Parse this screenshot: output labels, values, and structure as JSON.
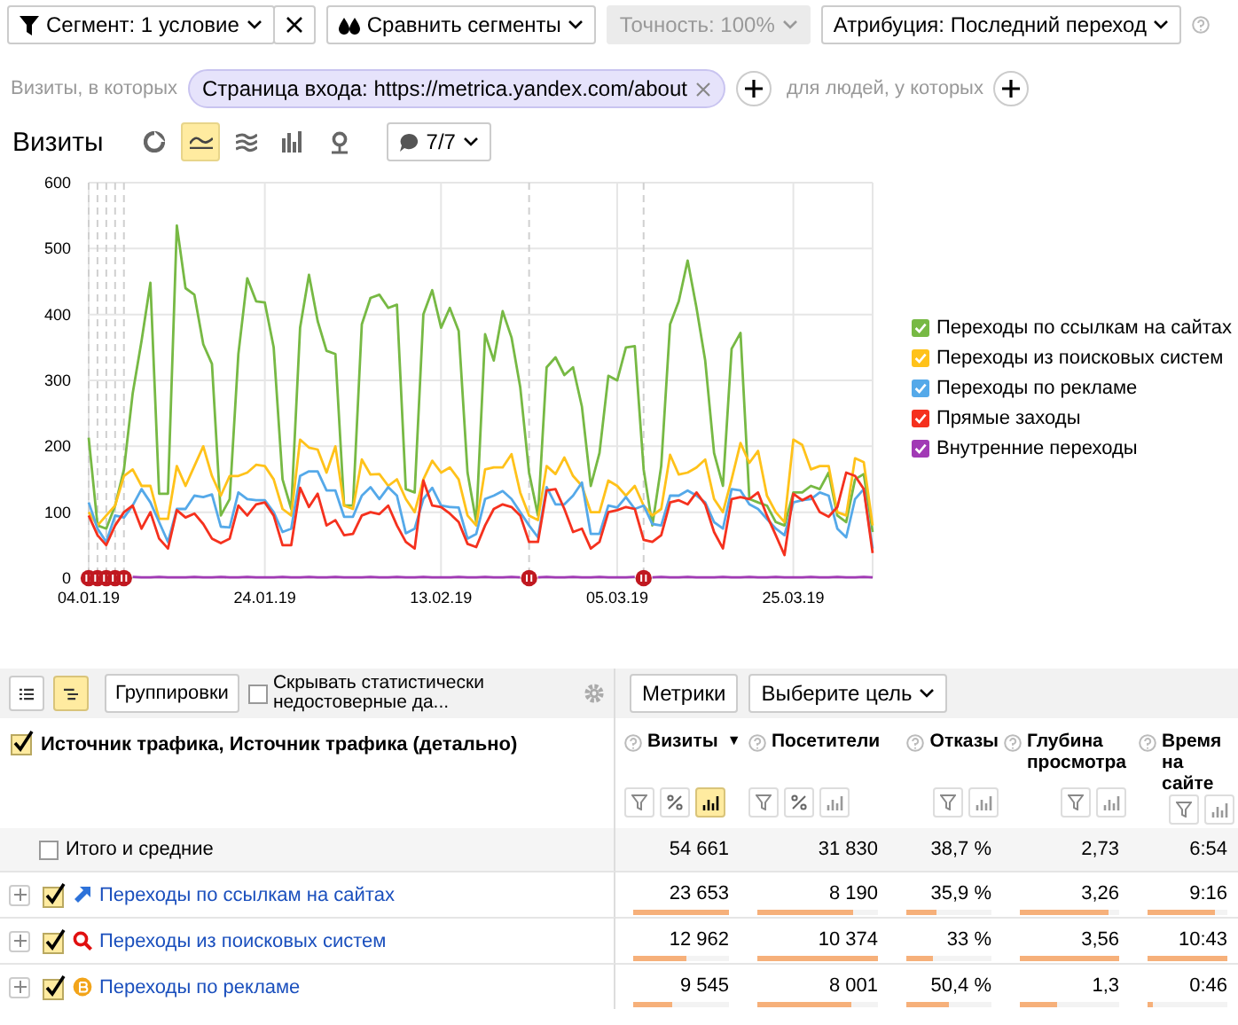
{
  "toolbar": {
    "items": [
      {
        "kind": "segment",
        "label": "Сегмент: 1 условие",
        "disabled": false
      },
      {
        "kind": "clear",
        "disabled": false
      },
      {
        "kind": "compare",
        "label": "Сравнить сегменты",
        "disabled": false
      },
      {
        "kind": "accuracy",
        "label": "Точность: 100%",
        "disabled": true
      },
      {
        "kind": "attribution",
        "label": "Атрибуция: Последний переход",
        "disabled": false
      }
    ]
  },
  "segment_filter": {
    "visits_label": "Визиты, в которых",
    "condition": "Страница входа: https://metrica.yandex.com/about",
    "people_label": "для людей, у которых"
  },
  "report": {
    "title": "Визиты",
    "views": [
      {
        "kind": "pie",
        "selected": false
      },
      {
        "kind": "line",
        "selected": true
      },
      {
        "kind": "area",
        "selected": false
      },
      {
        "kind": "bar",
        "selected": false
      },
      {
        "kind": "map",
        "selected": false
      }
    ],
    "notes_button": "7/7"
  },
  "chart": {
    "chart_data": {
      "type": "line",
      "categories": [
        "04.01.19",
        null,
        null,
        null,
        null,
        null,
        null,
        null,
        null,
        null,
        null,
        null,
        null,
        null,
        null,
        null,
        null,
        null,
        null,
        null,
        "24.01.19",
        null,
        null,
        null,
        null,
        null,
        null,
        null,
        null,
        null,
        null,
        null,
        null,
        null,
        null,
        null,
        null,
        null,
        null,
        null,
        "13.02.19",
        null,
        null,
        null,
        null,
        null,
        null,
        null,
        null,
        null,
        null,
        null,
        null,
        null,
        null,
        null,
        null,
        null,
        null,
        null,
        "05.03.19",
        null,
        null,
        null,
        null,
        null,
        null,
        null,
        null,
        null,
        null,
        null,
        null,
        null,
        null,
        null,
        null,
        null,
        null,
        null,
        "25.03.19",
        null,
        null,
        null,
        null,
        null,
        null,
        null,
        null,
        null
      ],
      "ylim": [
        0,
        600
      ],
      "grid": true,
      "yticks": [
        0,
        100,
        200,
        300,
        400,
        500,
        600
      ],
      "series": [
        {
          "name": "Переходы по ссылкам на сайтах",
          "color": "#77b944",
          "values": [
            213,
            80,
            75,
            110,
            165,
            280,
            360,
            448,
            128,
            128,
            535,
            440,
            430,
            355,
            325,
            95,
            120,
            340,
            455,
            420,
            418,
            350,
            150,
            105,
            380,
            460,
            390,
            345,
            340,
            110,
            110,
            385,
            425,
            430,
            410,
            415,
            135,
            130,
            400,
            437,
            380,
            410,
            375,
            160,
            85,
            370,
            330,
            405,
            365,
            290,
            160,
            95,
            320,
            335,
            308,
            320,
            260,
            140,
            190,
            307,
            300,
            350,
            352,
            165,
            80,
            170,
            385,
            420,
            482,
            410,
            330,
            190,
            140,
            348,
            372,
            120,
            115,
            110,
            85,
            80,
            130,
            130,
            140,
            135,
            160,
            95,
            85,
            150,
            158,
            70
          ]
        },
        {
          "name": "Переходы из поисковых систем",
          "color": "#ffc21a",
          "values": [
            100,
            80,
            95,
            110,
            155,
            165,
            140,
            140,
            90,
            90,
            170,
            140,
            170,
            200,
            155,
            125,
            155,
            155,
            160,
            172,
            170,
            150,
            105,
            95,
            210,
            198,
            195,
            160,
            200,
            110,
            105,
            180,
            157,
            158,
            140,
            150,
            120,
            100,
            150,
            178,
            160,
            168,
            150,
            95,
            80,
            165,
            168,
            168,
            188,
            130,
            95,
            88,
            170,
            158,
            183,
            155,
            140,
            100,
            100,
            148,
            140,
            125,
            140,
            110,
            95,
            105,
            187,
            157,
            160,
            168,
            180,
            120,
            100,
            150,
            205,
            175,
            193,
            125,
            100,
            85,
            210,
            202,
            165,
            170,
            170,
            100,
            95,
            182,
            176,
            80
          ]
        },
        {
          "name": "Переходы по рекламе",
          "color": "#55a9e9",
          "values": [
            115,
            75,
            55,
            95,
            92,
            110,
            135,
            115,
            85,
            55,
            105,
            105,
            125,
            123,
            127,
            78,
            77,
            130,
            120,
            118,
            118,
            100,
            70,
            75,
            155,
            162,
            162,
            133,
            133,
            93,
            93,
            125,
            138,
            120,
            138,
            125,
            68,
            75,
            120,
            137,
            110,
            108,
            107,
            60,
            67,
            120,
            125,
            132,
            120,
            100,
            80,
            62,
            138,
            112,
            112,
            125,
            145,
            67,
            67,
            110,
            107,
            123,
            105,
            110,
            82,
            80,
            125,
            125,
            133,
            125,
            115,
            85,
            75,
            135,
            133,
            112,
            105,
            90,
            75,
            65,
            115,
            118,
            120,
            130,
            125,
            75,
            62,
            120,
            135,
            45
          ]
        },
        {
          "name": "Прямые заходы",
          "color": "#f5311e",
          "values": [
            95,
            65,
            50,
            80,
            100,
            110,
            75,
            100,
            60,
            45,
            103,
            92,
            98,
            82,
            60,
            53,
            60,
            110,
            95,
            112,
            115,
            95,
            50,
            50,
            137,
            108,
            128,
            80,
            88,
            65,
            67,
            95,
            100,
            97,
            110,
            80,
            55,
            45,
            148,
            110,
            108,
            98,
            85,
            52,
            47,
            80,
            105,
            112,
            108,
            95,
            55,
            55,
            133,
            135,
            105,
            70,
            75,
            45,
            55,
            100,
            103,
            108,
            105,
            58,
            55,
            65,
            115,
            118,
            112,
            130,
            112,
            70,
            45,
            120,
            123,
            120,
            130,
            95,
            65,
            35,
            128,
            118,
            125,
            100,
            93,
            108,
            160,
            155,
            135,
            38
          ]
        },
        {
          "name": "Внутренние переходы",
          "color": "#a13ab5",
          "values": [
            null,
            null,
            null,
            null,
            null,
            2,
            1,
            1,
            2,
            1,
            1,
            1,
            2,
            1,
            1,
            2,
            1,
            1,
            2,
            1,
            1,
            1,
            2,
            1,
            1,
            2,
            1,
            1,
            2,
            1,
            1,
            1,
            2,
            1,
            1,
            2,
            1,
            1,
            2,
            1,
            1,
            1,
            2,
            1,
            1,
            2,
            1,
            1,
            2,
            1,
            null,
            1,
            2,
            1,
            1,
            2,
            1,
            1,
            2,
            1,
            1,
            1,
            2,
            null,
            1,
            2,
            1,
            1,
            2,
            1,
            1,
            1,
            2,
            1,
            1,
            2,
            1,
            1,
            2,
            1,
            1,
            1,
            2,
            1,
            1,
            2,
            1,
            1,
            2,
            1
          ]
        }
      ]
    },
    "legend": [
      {
        "checked": true
      },
      {
        "checked": true
      },
      {
        "checked": true
      },
      {
        "checked": true
      },
      {
        "checked": true
      }
    ]
  },
  "table": {
    "toolbar": {
      "views": [
        {
          "kind": "list",
          "selected": false
        },
        {
          "kind": "tree",
          "selected": true
        }
      ],
      "groupings_button": "Группировки",
      "hide_unreliable": {
        "label": "Скрывать статистически недостоверные да...",
        "checked": false
      },
      "metrics_button": "Метрики",
      "goal_select": "Выберите цель"
    },
    "dimension_header": {
      "label": "Источник трафика, Источник трафика (детально)",
      "checked": true
    },
    "columns": [
      {
        "label": "Визиты",
        "sort": "▼",
        "tools": [
          {
            "kind": "filter",
            "selected": false
          },
          {
            "kind": "percent",
            "selected": false
          },
          {
            "kind": "chart",
            "selected": true
          }
        ]
      },
      {
        "label": "Посетители",
        "tools": [
          {
            "kind": "filter",
            "selected": false
          },
          {
            "kind": "percent",
            "selected": false
          },
          {
            "kind": "chart",
            "selected": false
          }
        ]
      },
      {
        "label": "Отказы",
        "tools": [
          {
            "kind": "filter",
            "selected": false
          },
          {
            "kind": "chart",
            "selected": false
          }
        ]
      },
      {
        "label": "Глубина просмотра",
        "tools": [
          {
            "kind": "filter",
            "selected": false
          },
          {
            "kind": "chart",
            "selected": false
          }
        ]
      },
      {
        "label": "Время на сайте",
        "tools": [
          {
            "kind": "filter",
            "selected": false
          },
          {
            "kind": "chart",
            "selected": false
          }
        ]
      }
    ],
    "totals": {
      "label": "Итого и средние",
      "checked": false,
      "values": [
        "54 661",
        "31 830",
        "38,7 %",
        "2,73",
        "6:54"
      ]
    },
    "rows": [
      {
        "label": "Переходы по ссылкам на сайтах",
        "kind": "arrow",
        "checked": true,
        "expanded": false,
        "cells": [
          {
            "value": "23 653",
            "level": 1
          },
          {
            "value": "8 190",
            "level": 0.8
          },
          {
            "value": "35,9 %",
            "level": 0.36
          },
          {
            "value": "3,26",
            "level": 0.9
          },
          {
            "value": "9:16",
            "level": 0.85
          }
        ]
      },
      {
        "label": "Переходы из поисковых систем",
        "kind": "search",
        "checked": true,
        "expanded": false,
        "cells": [
          {
            "value": "12 962",
            "level": 0.55
          },
          {
            "value": "10 374",
            "level": 1
          },
          {
            "value": "33 %",
            "level": 0.31
          },
          {
            "value": "3,56",
            "level": 1
          },
          {
            "value": "10:43",
            "level": 1
          }
        ]
      },
      {
        "label": "Переходы по рекламе",
        "kind": "coin",
        "checked": true,
        "expanded": false,
        "cells": [
          {
            "value": "9 545",
            "level": 0.4
          },
          {
            "value": "8 001",
            "level": 0.78
          },
          {
            "value": "50,4 %",
            "level": 0.5
          },
          {
            "value": "1,3",
            "level": 0.38
          },
          {
            "value": "0:46",
            "level": 0.07
          }
        ]
      }
    ]
  }
}
